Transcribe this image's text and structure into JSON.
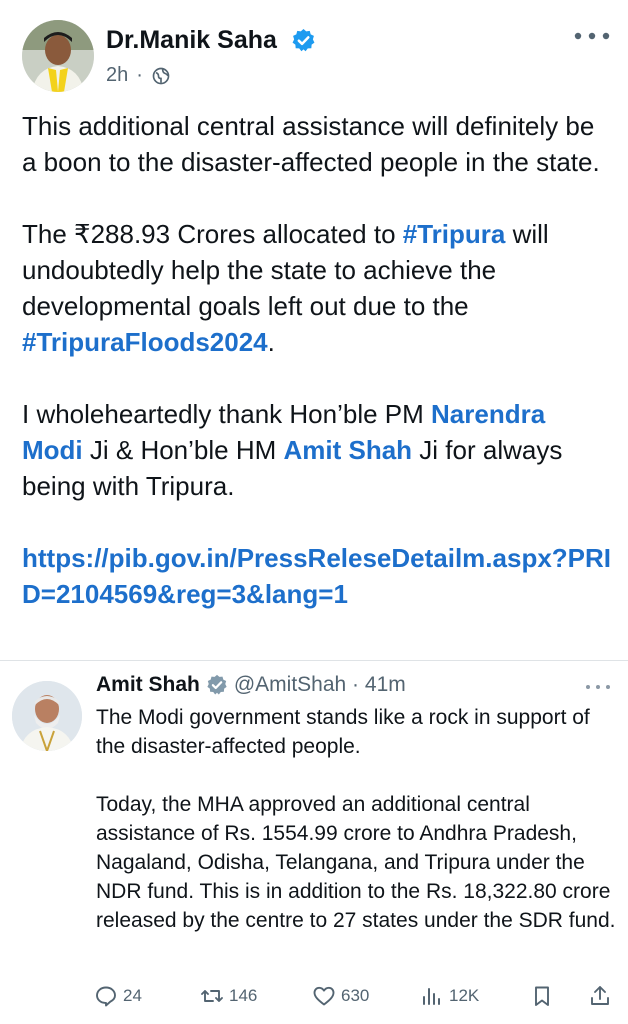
{
  "post": {
    "author_name": "Dr.Manik Saha",
    "time": "2h",
    "paragraphs": {
      "p1": "This additional central assistance will definitely be a boon to the disaster-affected people in the state.",
      "p2_a": "The ₹288.93 Crores allocated to ",
      "p2_tag1": "#Tripura",
      "p2_b": " will undoubtedly help the state to achieve the developmental goals left out due to the ",
      "p2_tag2": "#TripuraFloods2024",
      "p2_c": ".",
      "p3_a": "I wholeheartedly thank Hon’ble PM ",
      "p3_mention1": "Narendra Modi",
      "p3_b": " Ji & Hon’ble HM ",
      "p3_mention2": "Amit Shah",
      "p3_c": " Ji for always being with Tripura.",
      "link": "https://pib.gov.in/PressReleseDetailm.aspx?PRID=2104569&reg=3&lang=1"
    }
  },
  "quote": {
    "name": "Amit Shah",
    "handle": "@AmitShah",
    "time": "41m",
    "p1": "The Modi government stands like a rock in support of the disaster-affected people.",
    "p2": "Today, the MHA approved an additional central assistance of Rs. 1554.99 crore to Andhra Pradesh, Nagaland, Odisha, Telangana, and Tripura under the NDR fund. This is in addition to the Rs. 18,322.80 crore released by the centre to 27 states under the SDR fund."
  },
  "actions": {
    "replies": "24",
    "reposts": "146",
    "likes": "630",
    "views": "12K"
  },
  "colors": {
    "link": "#1d6fcb",
    "verified": "#1d9bf0",
    "secondary_text": "#536471"
  }
}
